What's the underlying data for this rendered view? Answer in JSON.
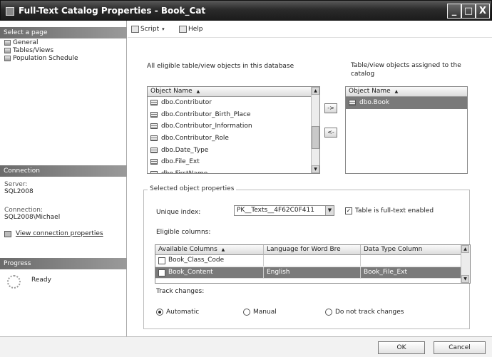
{
  "window": {
    "title": "Full-Text Catalog Properties - Book_Cat",
    "controls": [
      "_",
      "□",
      "X"
    ]
  },
  "left": {
    "select_page_label": "Select a page",
    "pages": [
      "General",
      "Tables/Views",
      "Population Schedule"
    ],
    "connection_header": "Connection",
    "server_label": "Server:",
    "server_value": "SQL2008",
    "connection_label": "Connection:",
    "connection_value": "SQL2008\\Michael",
    "view_connection_link": "View connection properties",
    "progress_header": "Progress",
    "progress_status": "Ready"
  },
  "toolbar": {
    "script_label": "Script",
    "help_label": "Help"
  },
  "eligible": {
    "heading": "All eligible table/view objects in this database",
    "column_header": "Object Name",
    "items": [
      "dbo.Contributor",
      "dbo.Contributor_Birth_Place",
      "dbo.Contributor_Information",
      "dbo.Contributor_Role",
      "dbo.Date_Type",
      "dbo.File_Ext",
      "dbo.FirstName"
    ]
  },
  "transfer": {
    "add_label": "->",
    "remove_label": "<-"
  },
  "assigned": {
    "heading": "Table/view objects assigned to the catalog",
    "column_header": "Object Name",
    "items": [
      "dbo.Book"
    ]
  },
  "properties": {
    "group_title": "Selected object properties",
    "unique_index_label": "Unique index:",
    "unique_index_value": "PK__Texts__4F62C0F411",
    "fulltext_enabled_label": "Table is full-text enabled",
    "fulltext_enabled": true,
    "eligible_columns_label": "Eligible columns:",
    "columns_headers": [
      "Available Columns",
      "Language for Word Bre",
      "Data Type Column"
    ],
    "columns_rows": [
      {
        "checked": false,
        "name": "Book_Class_Code",
        "language": "",
        "datatype": ""
      },
      {
        "checked": true,
        "name": "Book_Content",
        "language": "English",
        "datatype": "Book_File_Ext"
      }
    ],
    "track_changes_label": "Track changes:",
    "track_options": [
      "Automatic",
      "Manual",
      "Do not track changes"
    ],
    "track_selected": "Automatic"
  },
  "buttons": {
    "ok_label": "OK",
    "cancel_label": "Cancel"
  }
}
